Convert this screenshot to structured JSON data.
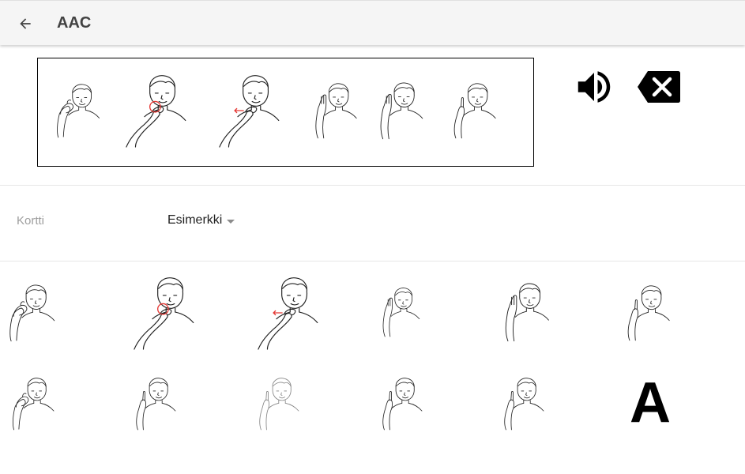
{
  "header": {
    "title": "AAC",
    "back_icon": "arrow-left-icon"
  },
  "sentence": {
    "cards": [
      {
        "icon": "sign-thumb-hand-icon"
      },
      {
        "icon": "sign-hand-at-chin-red-circle-icon"
      },
      {
        "icon": "sign-hand-at-chin-red-arrow-icon"
      },
      {
        "icon": "sign-flat-hand-up-icon"
      },
      {
        "icon": "sign-hand-at-cheek-icon"
      },
      {
        "icon": "sign-index-finger-up-icon"
      }
    ],
    "speak_icon": "speaker-icon",
    "clear_icon": "backspace-icon"
  },
  "selector": {
    "label": "Kortti",
    "value": "Esimerkki"
  },
  "grid": {
    "cards": [
      {
        "icon": "sign-thumb-hand-icon"
      },
      {
        "icon": "sign-hand-at-chin-red-circle-icon"
      },
      {
        "icon": "sign-hand-at-chin-red-arrow-icon"
      },
      {
        "icon": "sign-flat-hand-up-icon"
      },
      {
        "icon": "sign-hand-at-cheek-icon"
      },
      {
        "icon": "sign-index-finger-up-icon"
      },
      {
        "icon": "sign-fist-icon"
      },
      {
        "icon": "sign-thumb-up-hand-icon"
      },
      {
        "icon": "sign-pointing-hand-faint-icon"
      },
      {
        "icon": "sign-crossed-fingers-icon"
      },
      {
        "icon": "sign-thumb-side-hand-icon"
      },
      {
        "icon": "letter-a-card",
        "text": "A"
      }
    ]
  },
  "colors": {
    "appbar": "#f5f5f5",
    "title": "#424242",
    "label": "#9e9e9e",
    "accent_red": "#e53935"
  }
}
